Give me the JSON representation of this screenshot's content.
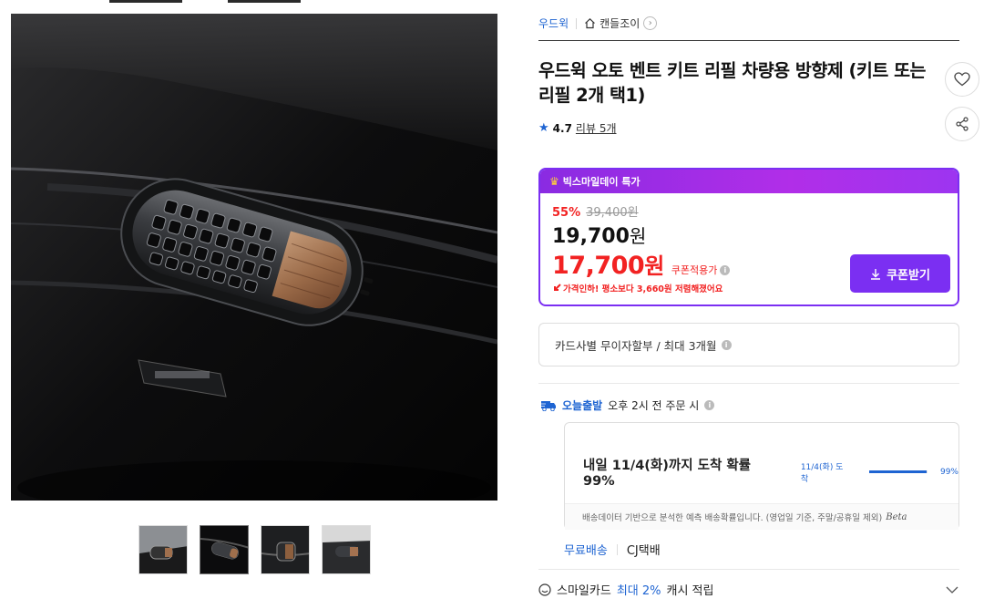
{
  "breadcrumb": {
    "brand": "우드윅",
    "category": "캔들조이"
  },
  "product": {
    "title": "우드윅 오토 벤트 키트 리필 차량용 방향제 (키트 또는 리필 2개 택1)",
    "rating": "4.7",
    "review_link": "리뷰 5개"
  },
  "icons": {
    "like": "heart-icon",
    "share": "share-icon",
    "home": "home-icon",
    "star": "star-icon",
    "crown": "crown-icon",
    "truck": "truck-icon",
    "chevron": "chevron-down-icon",
    "smile": "smile-icon",
    "download": "download-icon"
  },
  "price": {
    "promo_label": "빅스마일데이 특가",
    "discount_rate": "55%",
    "original_price": "39,400원",
    "sale_number": "19,700",
    "sale_unit": "원",
    "coupon_number": "17,700",
    "coupon_unit": "원",
    "coupon_label": "쿠폰적용가",
    "price_drop_note": "가격인하! 평소보다 3,660원 저렴해졌어요",
    "coupon_button": "쿠폰받기",
    "accent_color": "#7b2ff2",
    "sale_color": "#f22222"
  },
  "installment": {
    "text": "카드사별 무이자할부 / 최대 3개월"
  },
  "delivery": {
    "today_label": "오늘출발",
    "cutoff_text": "오후 2시 전 주문 시",
    "arrival_text": "내일 11/4(화)까지 도착 확률 99%",
    "arrival_mini": "11/4(화) 도착",
    "probability_percent": 99,
    "probability_label": "99%",
    "note": "배송데이터 기반으로 분석한 예측 배송확률입니다. (영업일 기준, 주말/공휴일 제외)",
    "beta": "Beta",
    "free_shipping": "무료배송",
    "carrier": "CJ택배"
  },
  "smile_card": {
    "prefix": "스마일카드",
    "max": "최대 2%",
    "suffix": "캐시 적립"
  }
}
